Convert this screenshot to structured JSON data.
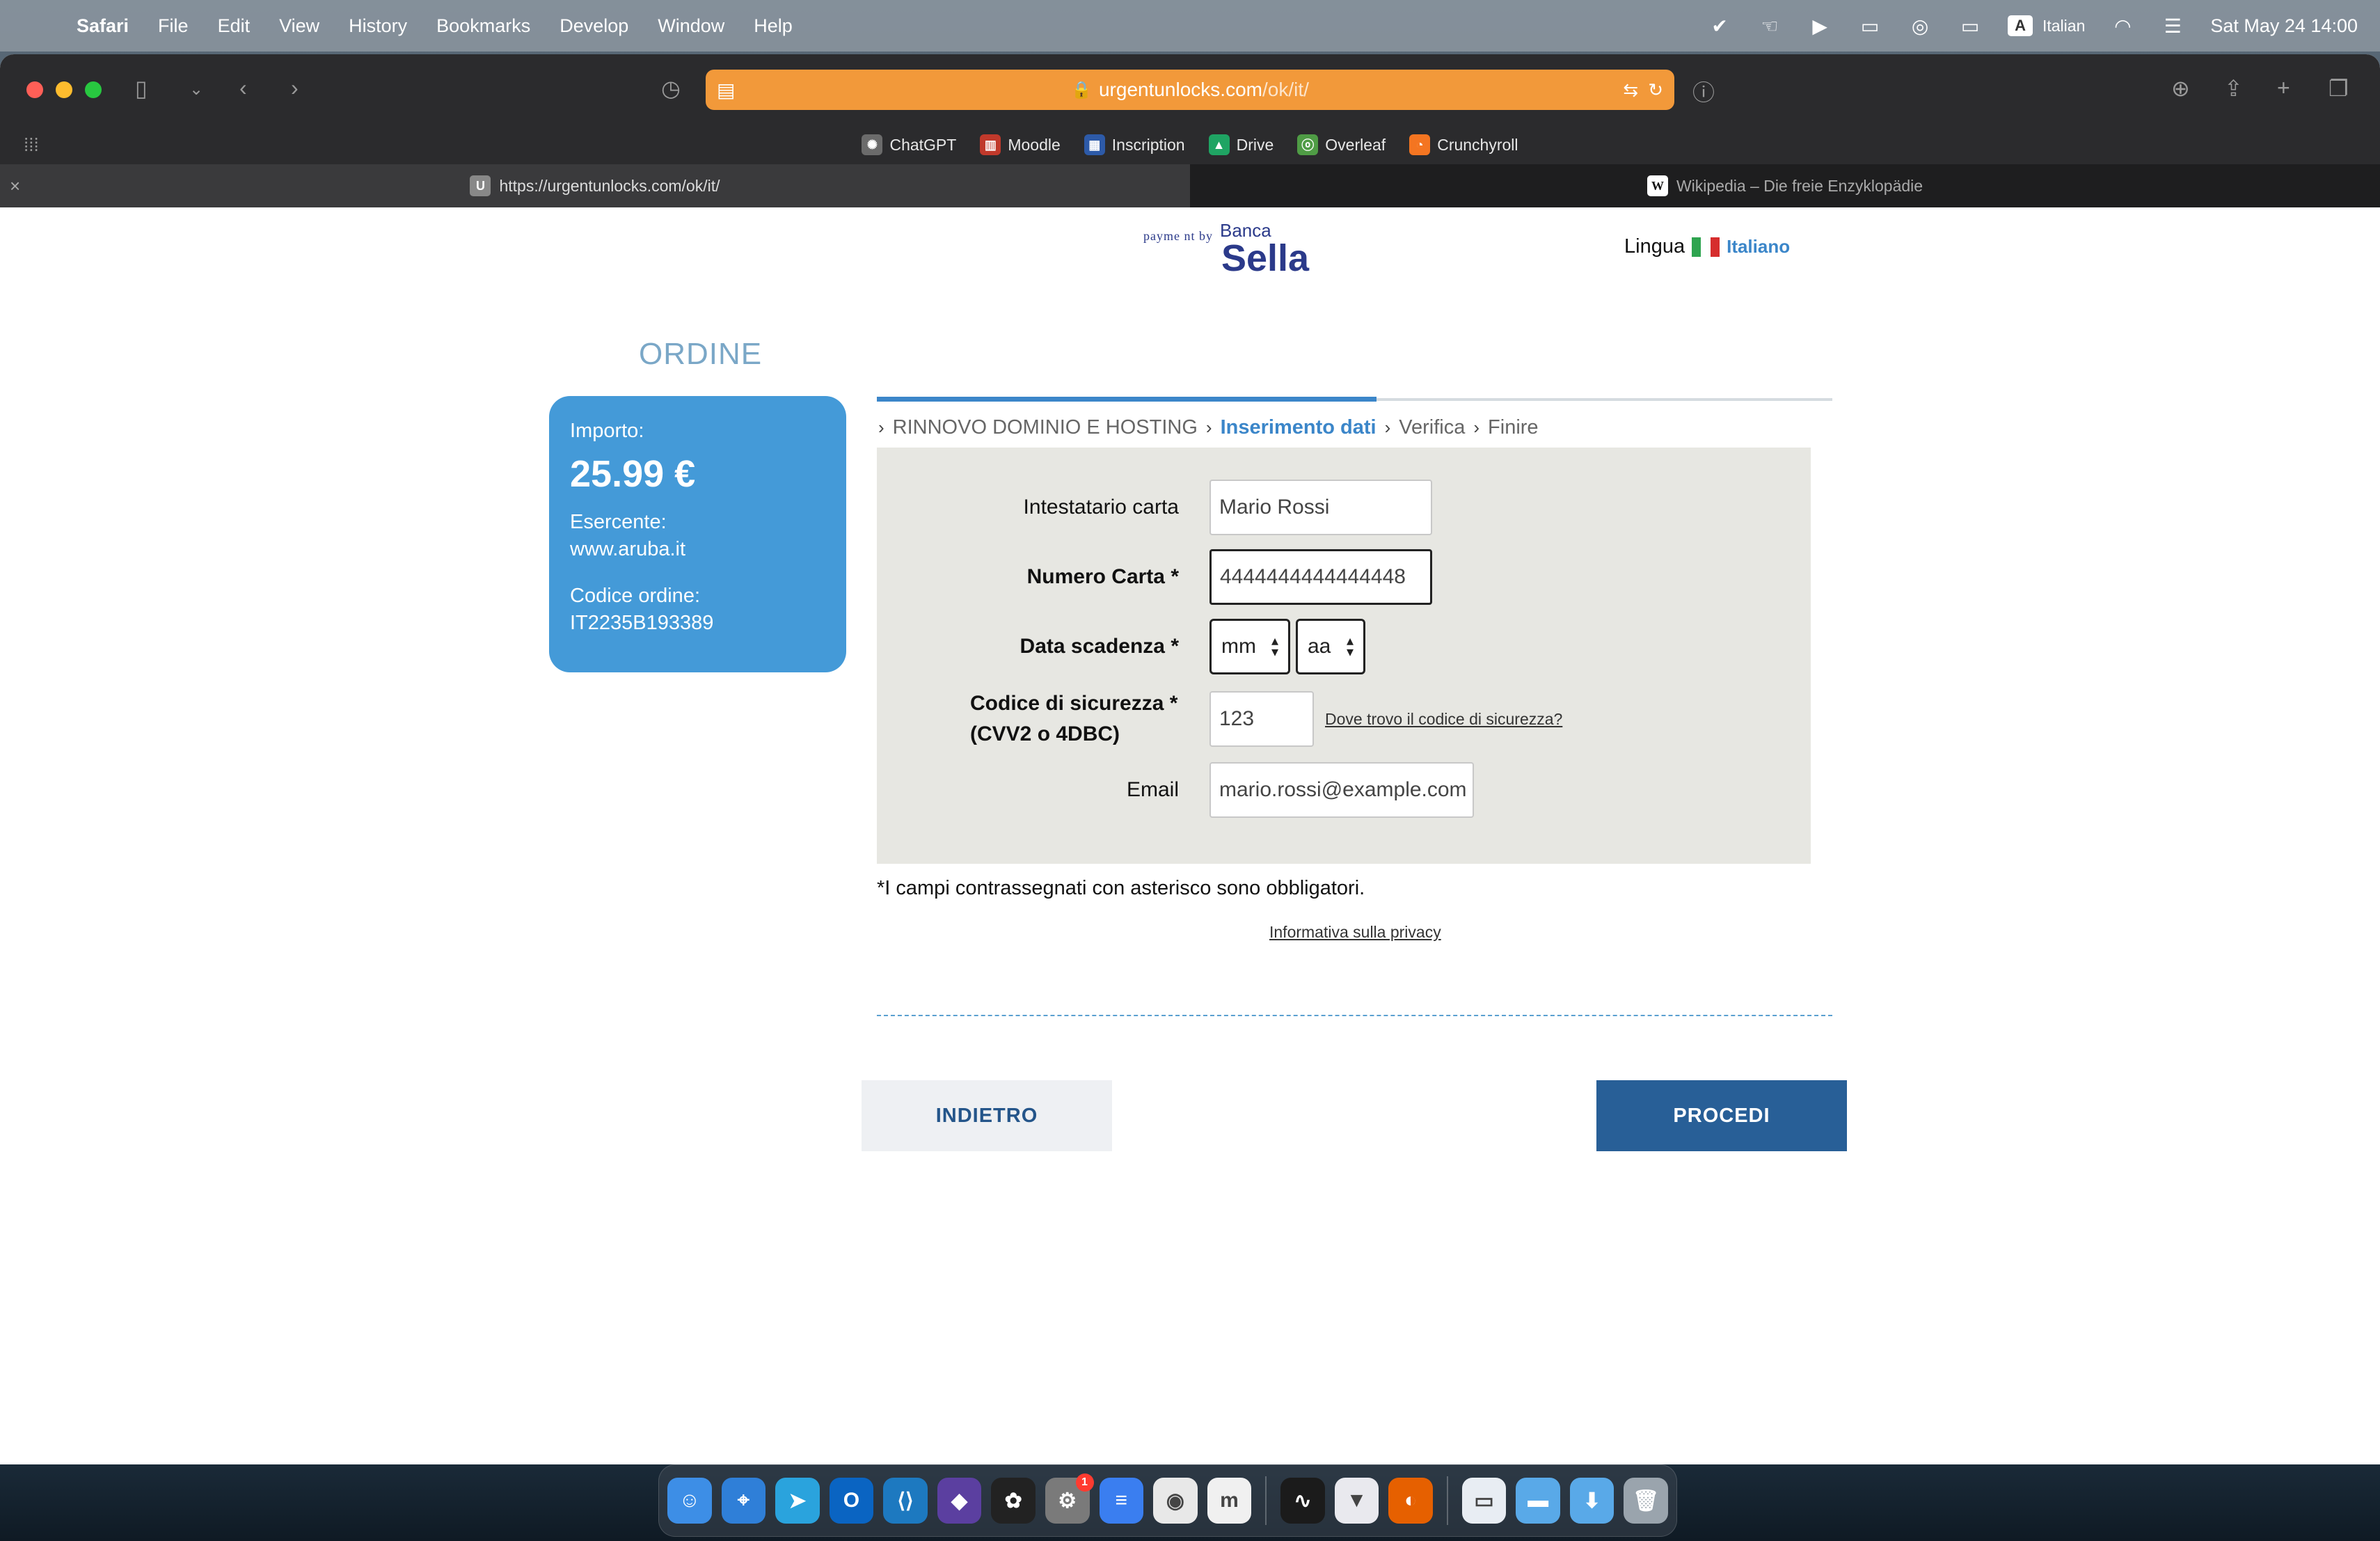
{
  "menubar": {
    "app": "Safari",
    "items": [
      "File",
      "Edit",
      "View",
      "History",
      "Bookmarks",
      "Develop",
      "Window",
      "Help"
    ],
    "input_source": "A",
    "language": "Italian",
    "datetime": "Sat May 24  14:00"
  },
  "browser": {
    "url_host": "urgentunlocks.com",
    "url_path": "/ok/it/",
    "favorites": [
      {
        "label": "ChatGPT",
        "color": "#6b6b6b",
        "glyph": "✺"
      },
      {
        "label": "Moodle",
        "color": "#c0392b",
        "glyph": "▥"
      },
      {
        "label": "Inscription",
        "color": "#2d5aa8",
        "glyph": "▦"
      },
      {
        "label": "Drive",
        "color": "#1fa463",
        "glyph": "▲"
      },
      {
        "label": "Overleaf",
        "color": "#4f9c45",
        "glyph": "ⓞ"
      },
      {
        "label": "Crunchyroll",
        "color": "#f47521",
        "glyph": "◔"
      }
    ],
    "tabs": [
      {
        "title": "https://urgentunlocks.com/ok/it/",
        "favicon": "U"
      },
      {
        "title": "Wikipedia – Die freie Enzyklopädie",
        "favicon": "W"
      }
    ]
  },
  "header": {
    "payment_by": "payme nt by",
    "bank_line1": "Banca",
    "bank_line2": "Sella",
    "lingua_label": "Lingua",
    "language": "Italiano"
  },
  "order": {
    "title": "ORDINE",
    "amount_label": "Importo:",
    "amount": "25.99 €",
    "merchant_label": "Esercente:",
    "merchant": "www.aruba.it",
    "code_label": "Codice ordine:",
    "code": "IT2235B193389"
  },
  "steps": [
    {
      "label": "RINNOVO DOMINIO E HOSTING",
      "active": false
    },
    {
      "label": "Inserimento dati",
      "active": true
    },
    {
      "label": "Verifica",
      "active": false
    },
    {
      "label": "Finire",
      "active": false
    }
  ],
  "form": {
    "holder_label": "Intestatario carta",
    "holder_value": "Mario Rossi",
    "card_label": "Numero Carta *",
    "card_value": "4444444444444448",
    "expiry_label": "Data scadenza *",
    "expiry_month": "mm",
    "expiry_year": "aa",
    "cvv_label_line1": "Codice di sicurezza *",
    "cvv_label_line2": "(CVV2 o 4DBC)",
    "cvv_value": "123",
    "cvv_help": "Dove trovo il codice di sicurezza?",
    "email_label": "Email",
    "email_value": "mario.rossi@example.com"
  },
  "footer": {
    "required_note": "*I campi contrassegnati con asterisco sono obbligatori.",
    "privacy_link": "Informativa sulla privacy",
    "back_button": "INDIETRO",
    "next_button": "PROCEDI"
  },
  "colors": {
    "accent": "#3b86c9",
    "order_card": "#449ad8",
    "primary_button": "#285f97",
    "url_bar": "#f2993a"
  },
  "dock": {
    "apps": [
      {
        "name": "finder-icon",
        "color": "#3d8ee6",
        "glyph": "☺"
      },
      {
        "name": "safari-icon",
        "color": "#2f7fd8",
        "glyph": "⌖"
      },
      {
        "name": "telegram-icon",
        "color": "#2aa3dd",
        "glyph": "➤"
      },
      {
        "name": "outlook-icon",
        "color": "#0a64c2",
        "glyph": "O"
      },
      {
        "name": "vscode-icon",
        "color": "#1d79c0",
        "glyph": "⟨⟩"
      },
      {
        "name": "obsidian-icon",
        "color": "#5b3fa0",
        "glyph": "◆"
      },
      {
        "name": "figma-icon",
        "color": "#222222",
        "glyph": "✿"
      },
      {
        "name": "system-settings-icon",
        "color": "#7a7a7a",
        "glyph": "⚙",
        "badge": "1"
      },
      {
        "name": "docs-icon",
        "color": "#3a7ef0",
        "glyph": "≡"
      },
      {
        "name": "chrome-icon",
        "color": "#e8e8e8",
        "glyph": "◉"
      },
      {
        "name": "moodle-icon",
        "color": "#f0f0f0",
        "glyph": "m"
      },
      {
        "name": "activity-monitor-icon",
        "color": "#1b1b1b",
        "glyph": "∿"
      },
      {
        "name": "vpn-icon",
        "color": "#e9e9ee",
        "glyph": "▼"
      },
      {
        "name": "firefox-icon",
        "color": "#e66000",
        "glyph": "◐"
      },
      {
        "name": "file-icon",
        "color": "#e8edf3",
        "glyph": "▭"
      },
      {
        "name": "folder-icon",
        "color": "#59a9e8",
        "glyph": "▬"
      },
      {
        "name": "downloads-folder-icon",
        "color": "#59a9e8",
        "glyph": "⬇"
      },
      {
        "name": "trash-icon",
        "color": "#9aa4ad",
        "glyph": "🗑"
      }
    ]
  }
}
